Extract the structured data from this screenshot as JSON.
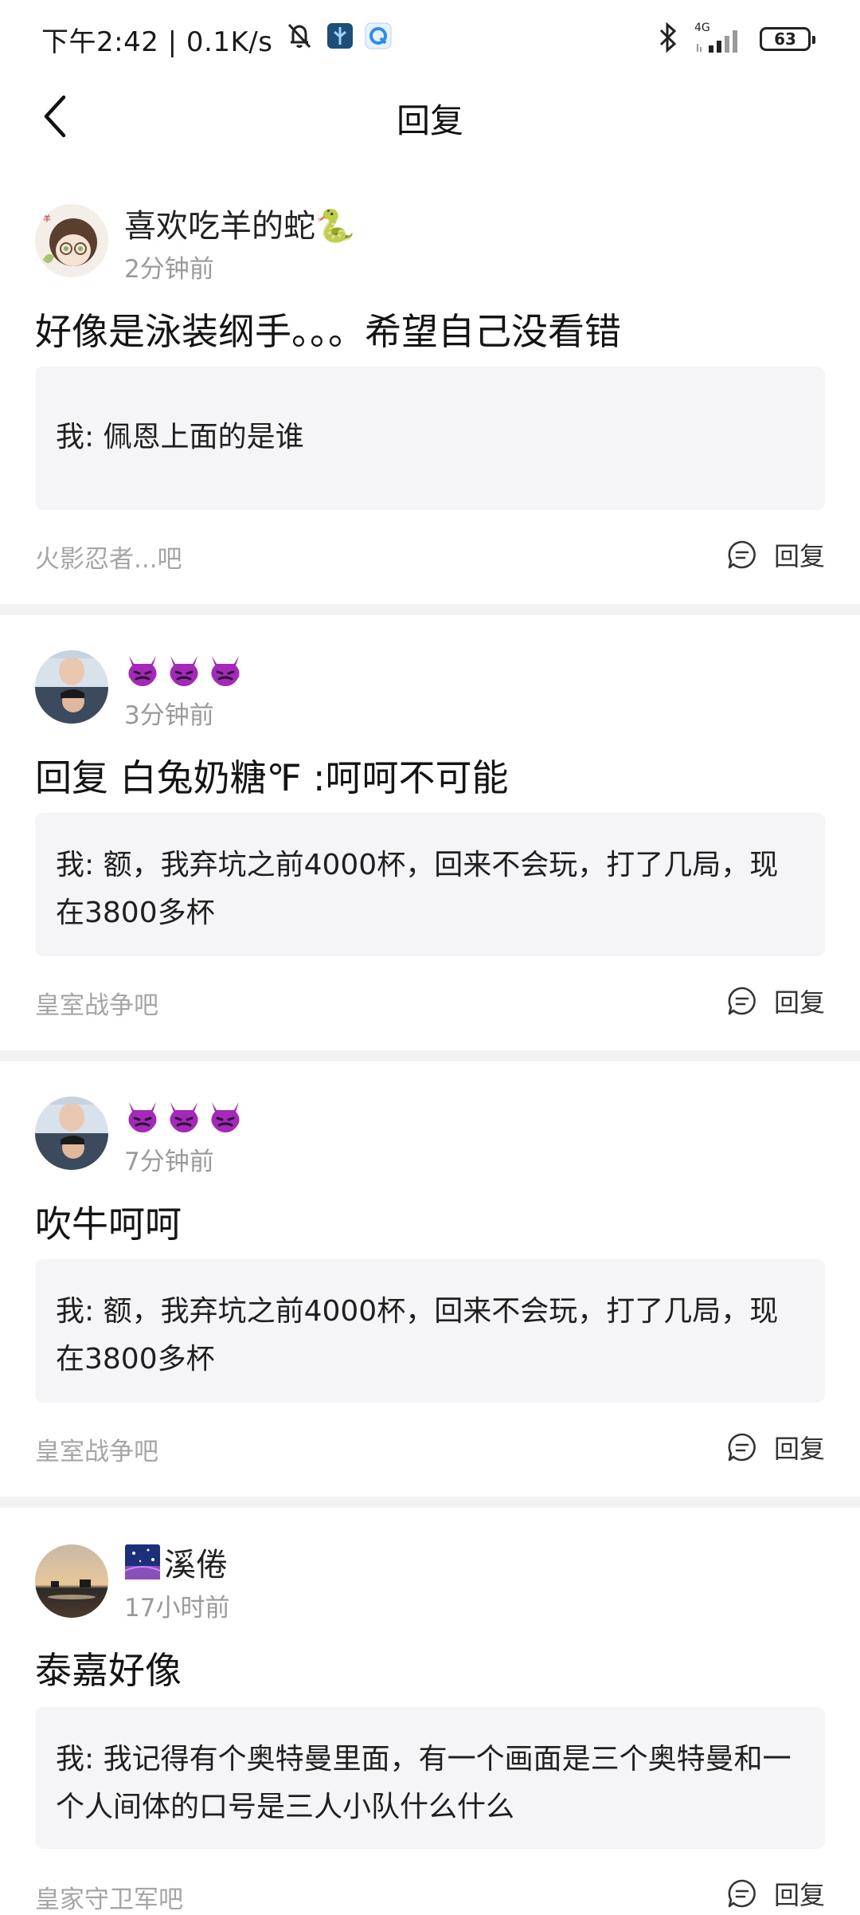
{
  "status_bar": {
    "time_speed": "下午2:42 | 0.1K/s",
    "network": "4G",
    "battery": "63"
  },
  "header": {
    "title": "回复"
  },
  "replies": [
    {
      "username": "喜欢吃羊的蛇🐍",
      "time": "2分钟前",
      "text": "好像是泳装纲手。。。希望自己没看错",
      "quote": "我: 佩恩上面的是谁",
      "forum": "火影忍者...吧",
      "reply_label": "回复"
    },
    {
      "username": "",
      "time": "3分钟前",
      "text": "回复  白兔奶糖℉ :呵呵不可能",
      "quote": "我: 额，我弃坑之前4000杯，回来不会玩，打了几局，现在3800多杯",
      "forum": "皇室战争吧",
      "reply_label": "回复"
    },
    {
      "username": "",
      "time": "7分钟前",
      "text": "吹牛呵呵",
      "quote": "我: 额，我弃坑之前4000杯，回来不会玩，打了几局，现在3800多杯",
      "forum": "皇室战争吧",
      "reply_label": "回复"
    },
    {
      "username": "溪倦",
      "time": "17小时前",
      "text": "泰嘉好像",
      "quote": "我: 我记得有个奥特曼里面，有一个画面是三个奥特曼和一个人间体的口号是三人小队什么什么",
      "forum": "皇家守卫军吧",
      "reply_label": "回复"
    }
  ]
}
